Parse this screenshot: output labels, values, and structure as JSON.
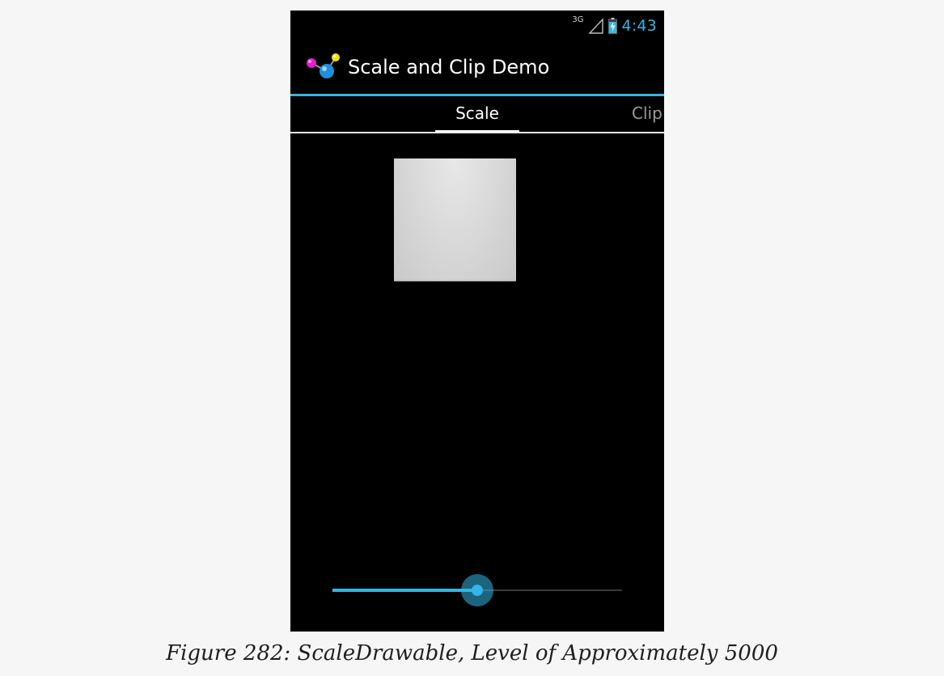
{
  "status_bar": {
    "network_type": "3G",
    "time": "4:43",
    "icons": [
      "signal-icon",
      "battery-charging-icon"
    ],
    "clock_color": "#33b5e5"
  },
  "action_bar": {
    "title": "Scale and Clip Demo",
    "icon": "molecule-app-icon",
    "accent_color": "#33b5e5"
  },
  "tabs": [
    {
      "label": "Scale",
      "selected": true
    },
    {
      "label": "Clip",
      "selected": false
    }
  ],
  "content": {
    "image": "scaled-gray-square"
  },
  "seekbar": {
    "progress_fraction": 0.5,
    "color": "#33b5e5"
  },
  "caption": "Figure 282: ScaleDrawable, Level of Approximately 5000"
}
